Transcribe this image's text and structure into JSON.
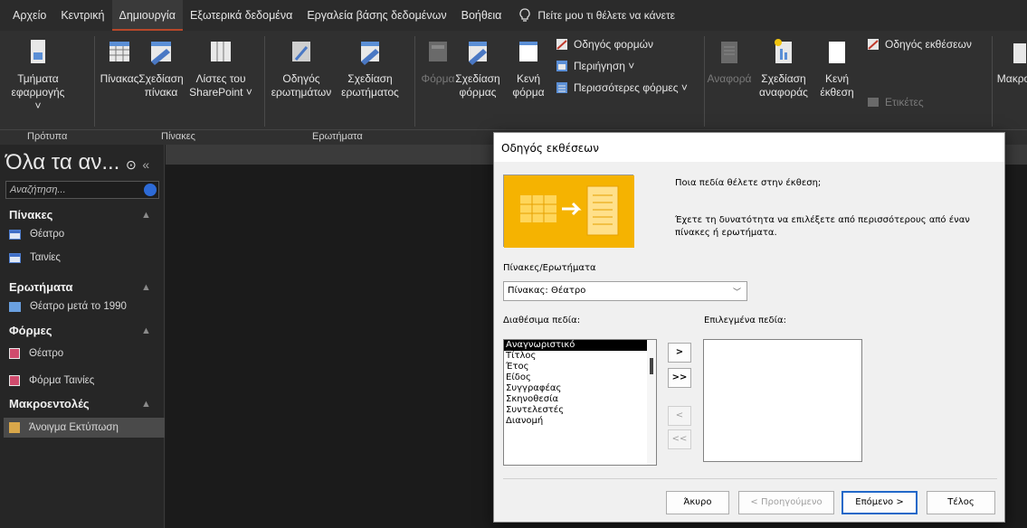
{
  "menu": {
    "tabs": [
      "Αρχείο",
      "Κεντρική",
      "Δημιουργία",
      "Εξωτερικά δεδομένα",
      "Εργαλεία βάσης δεδομένων",
      "Βοήθεια"
    ],
    "tell_me": "Πείτε μου τι θέλετε να κάνετε"
  },
  "ribbon": {
    "app_parts": "Τμήματα εφαρμογής ˅",
    "table": "Πίνακας",
    "table_design": "Σχεδίαση πίνακα",
    "sharepoint": "Λίστες του SharePoint ˅",
    "query_wizard": "Οδηγός ερωτημάτων",
    "query_design": "Σχεδίαση ερωτήματος",
    "form": "Φόρμα",
    "form_design": "Σχεδίαση φόρμας",
    "blank_form": "Κενή φόρμα",
    "form_wizard": "Οδηγός φορμών",
    "navigation": "Περιήγηση ˅",
    "more_forms": "Περισσότερες φόρμες ˅",
    "report": "Αναφορά",
    "report_design": "Σχεδίαση αναφοράς",
    "blank_report": "Κενή έκθεση",
    "report_wizard": "Οδηγός εκθέσεων",
    "labels": "Ετικέτες",
    "macro": "Μακρο",
    "groups": {
      "templates": "Πρότυπα",
      "tables": "Πίνακες",
      "queries": "Ερωτήματα"
    }
  },
  "nav": {
    "title": "Όλα τα αν...",
    "search_placeholder": "Αναζήτηση...",
    "groups": [
      {
        "label": "Πίνακες",
        "items": [
          "Θέατρο",
          "Ταινίες"
        ]
      },
      {
        "label": "Ερωτήματα",
        "items": [
          "Θέατρο μετά το 1990"
        ]
      },
      {
        "label": "Φόρμες",
        "items": [
          "Θέατρο",
          "Φόρμα Ταινίες"
        ]
      },
      {
        "label": "Μακροεντολές",
        "items": [
          "Άνοιγμα Εκτύπωση"
        ]
      }
    ]
  },
  "dialog": {
    "title": "Οδηγός εκθέσεων",
    "question": "Ποια πεδία θέλετε στην έκθεση;",
    "hint": "Έχετε τη δυνατότητα να επιλέξετε από περισσότερους από έναν πίνακες ή ερωτήματα.",
    "tables_label": "Πίνακες/Ερωτήματα",
    "tables_value": "Πίνακας: Θέατρο",
    "available_label": "Διαθέσιμα πεδία:",
    "selected_label": "Επιλεγμένα πεδία:",
    "available_fields": [
      "Αναγνωριστικό",
      "Τίτλος",
      "Έτος",
      "Είδος",
      "Συγγραφέας",
      "Σκηνοθεσία",
      "Συντελεστές",
      "Διανομή"
    ],
    "move_one": ">",
    "move_all": ">>",
    "remove_one": "<",
    "remove_all": "<<",
    "cancel": "Άκυρο",
    "back": "< Προηγούμενο",
    "next": "Επόμενο >",
    "finish": "Τέλος"
  },
  "colors": {
    "accent": "#b7472a",
    "dialog_primary": "#2168c8"
  }
}
